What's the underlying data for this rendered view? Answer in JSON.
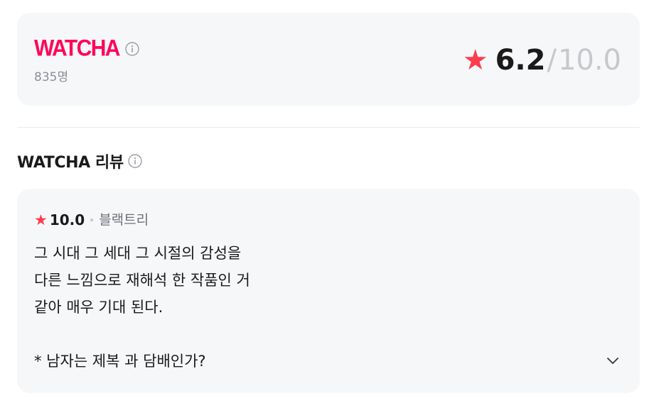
{
  "summary": {
    "brand": "WATCHA",
    "rating_count": "835명",
    "score": "6.2",
    "slash": "/",
    "max_score": "10.0",
    "star_color": "#ff3b4e",
    "brand_color": "#ff0558"
  },
  "reviews_section": {
    "title": "WATCHA 리뷰"
  },
  "review": {
    "score": "10.0",
    "user": "블랙트리",
    "text": "그 시대 그 세대 그 시절의 감성을\n다른 느낌으로 재해석 한 작품인 거\n같아 매우 기대 된다.\n\n* 남자는 제복 과 담배인가?"
  },
  "icons": {
    "info": "info-icon",
    "star": "star-icon",
    "expand": "chevron-down-icon"
  }
}
